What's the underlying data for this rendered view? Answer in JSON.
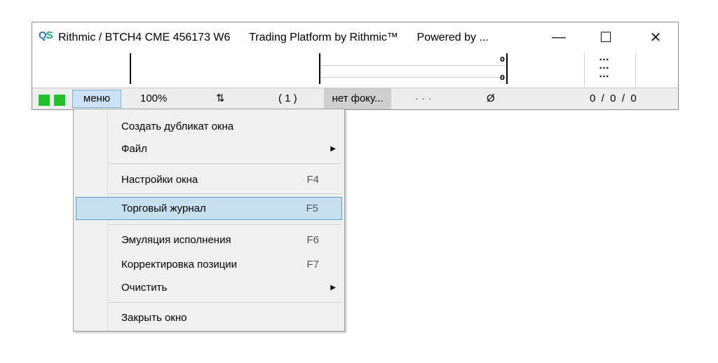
{
  "titlebar": {
    "logo_text": "QS",
    "title": "Rithmic / BTCH4 CME 456173 W6",
    "platform": "Trading Platform by Rithmic™",
    "powered": "Powered by ...",
    "minimize_glyph": "—",
    "maximize_glyph": "☐",
    "close_glyph": "✕"
  },
  "content": {
    "value_top": "0",
    "value_bottom": "0",
    "dots": "…\n…\n…"
  },
  "statusbar": {
    "indicator_color": "#22c02a",
    "menu_label": "меню",
    "zoom": "100%",
    "sort_icon": "⇅",
    "count": "( 1 )",
    "focus": "нет фоку...",
    "dots": "· · ·",
    "empty_set": "Ø",
    "totals": "0  /  0  /  0"
  },
  "menu": {
    "items": [
      {
        "label": "Создать дубликат окна",
        "shortcut": ""
      },
      {
        "label": "Файл",
        "shortcut": "",
        "submenu": true
      },
      {
        "label": "Настройки окна",
        "shortcut": "F4"
      },
      {
        "label": "Торговый журнал",
        "shortcut": "F5",
        "highlighted": true
      },
      {
        "label": "Эмуляция исполнения",
        "shortcut": "F6"
      },
      {
        "label": "Корректировка позиции",
        "shortcut": "F7"
      },
      {
        "label": "Очистить",
        "shortcut": "",
        "submenu": true
      },
      {
        "label": "Закрыть окно",
        "shortcut": ""
      }
    ],
    "submenu_arrow": "▶"
  }
}
